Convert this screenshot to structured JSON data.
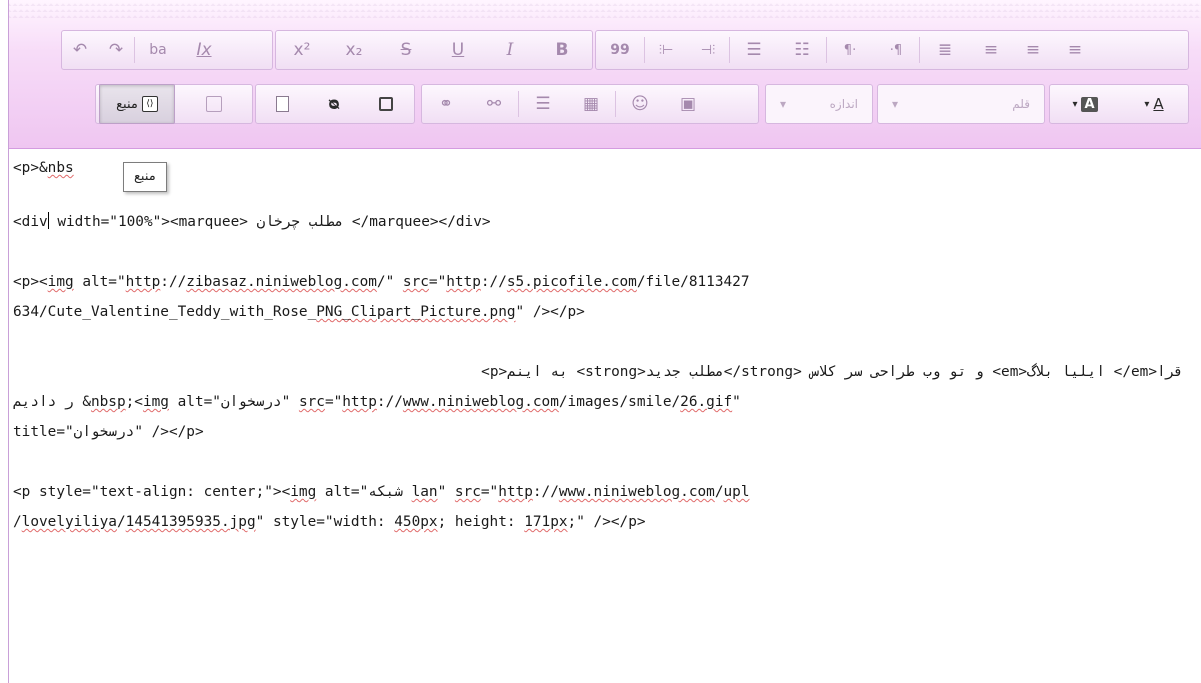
{
  "toolbar": {
    "row1": {
      "g1": [
        {
          "name": "undo-icon",
          "glyph": "↶"
        },
        {
          "name": "redo-icon",
          "glyph": "↷"
        },
        {
          "name": "replace-icon",
          "glyph": "ba"
        },
        {
          "name": "remove-format-icon",
          "glyph": "Ix"
        }
      ],
      "g2": [
        {
          "name": "superscript-icon",
          "glyph": "x²"
        },
        {
          "name": "subscript-icon",
          "glyph": "x₂"
        },
        {
          "name": "strikethrough-icon",
          "glyph": "S"
        },
        {
          "name": "underline-icon",
          "glyph": "U"
        },
        {
          "name": "italic-icon",
          "glyph": "I"
        },
        {
          "name": "bold-icon",
          "glyph": "B"
        }
      ],
      "g3": [
        {
          "name": "blockquote-icon",
          "glyph": "99"
        },
        {
          "name": "indent-icon",
          "glyph": "⫶⊢"
        },
        {
          "name": "outdent-icon",
          "glyph": "⊣⫶"
        },
        {
          "name": "bulleted-list-icon",
          "glyph": "☰"
        },
        {
          "name": "numbered-list-icon",
          "glyph": "☷"
        },
        {
          "name": "ltr-icon",
          "glyph": "¶·"
        },
        {
          "name": "rtl-icon",
          "glyph": "·¶"
        },
        {
          "name": "justify-icon",
          "glyph": "≣"
        },
        {
          "name": "align-right-icon",
          "glyph": "≡"
        },
        {
          "name": "align-center-icon",
          "glyph": "≡"
        },
        {
          "name": "align-left-icon",
          "glyph": "≡"
        }
      ]
    },
    "row2": {
      "source_label": "منبع",
      "source_icon": "source-icon",
      "size_label": "اندازه",
      "font_label": "قلم",
      "text_color_glyph": "A",
      "bg_color_glyph": "A",
      "combo_arrow": "▾"
    }
  },
  "tooltip": {
    "text": "منبع"
  },
  "code": {
    "line1": {
      "a": "<p>&",
      "b": "nbs",
      "c": ">"
    },
    "line2": {
      "a": "<div",
      "b": " width=\"100%\"><marquee> مطلب چرخان </marquee></div>"
    },
    "line3": {
      "a": "<p><",
      "img1": "img",
      "b": " alt=\"",
      "u1": "http",
      "c": "://",
      "u2": "zibasaz.niniweblog.com",
      "d": "/\" ",
      "src1": "src",
      "e": "=\"",
      "u3": "http",
      "f": "://",
      "u4": "s5.picofile.com",
      "g": "/file/8113427"
    },
    "line4": {
      "a": "634/Cute_Valentine_Teddy_with_Rose_",
      "u1": "PNG_Clipart_Picture.png",
      "b": "\" /></p>"
    },
    "line5": {
      "a": "<p>به اینم <strong>مطلب جدید</strong> و تو وب طراحی سر کلاس <em>ایلیا بلاگ </em>قرا"
    },
    "line6": {
      "a": "ر دادیم &",
      "u1": "nbsp",
      "b": ";<",
      "img": "img",
      "c": " alt=\"درسخوان\" ",
      "src": "src",
      "d": "=\"",
      "u2": "http",
      "e": "://",
      "u3": "www.niniweblog.com",
      "f": "/images/smile/",
      "u4": "26.gif",
      "g": "\""
    },
    "line7": {
      "a": "title=\"درسخوان\" /></p>"
    },
    "line8": {
      "a": "<p style=\"text-align: center;\"><",
      "img": "img",
      "b": " alt=\"شبکه ",
      "u1": "lan",
      "c": "\" ",
      "src": "src",
      "d": "=\"",
      "u2": "http",
      "e": "://",
      "u3": "www.niniweblog.com",
      "f": "/",
      "u4": "upl"
    },
    "line9": {
      "a": "/",
      "u1": "lovelyiliya",
      "b": "/",
      "u2": "14541395935.jpg",
      "c": "\" style=\"width: ",
      "u3": "450px",
      "d": "; height: ",
      "u4": "171px",
      "e": ";\" /></p>"
    }
  }
}
